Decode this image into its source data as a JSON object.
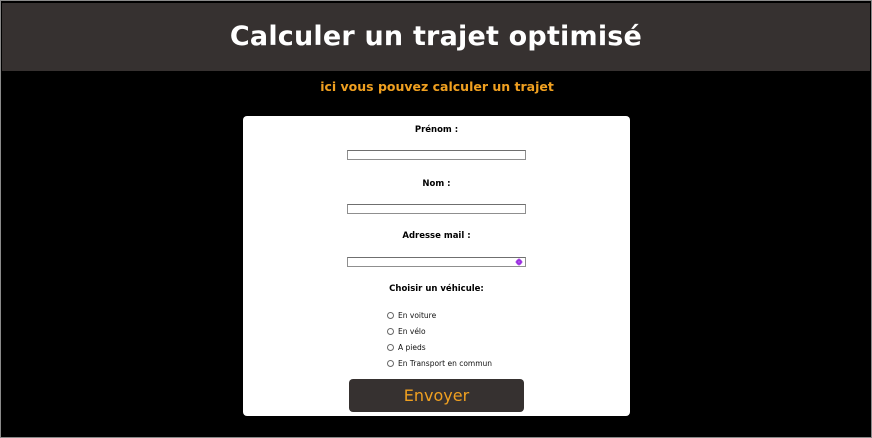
{
  "header": {
    "title": "Calculer un trajet optimisé"
  },
  "subtitle": "ici vous pouvez calculer un trajet",
  "form": {
    "first_name": {
      "label": "Prénom :",
      "value": ""
    },
    "last_name": {
      "label": "Nom :",
      "value": ""
    },
    "email": {
      "label": "Adresse mail :",
      "value": ""
    },
    "vehicle": {
      "label": "Choisir un véhicule:",
      "options": [
        {
          "label": "En voiture",
          "checked": false
        },
        {
          "label": "En vélo",
          "checked": false
        },
        {
          "label": "A pieds",
          "checked": false
        },
        {
          "label": "En Transport en commun",
          "checked": false
        }
      ]
    },
    "submit_label": "Envoyer"
  },
  "colors": {
    "background": "#000000",
    "header_bg": "#363130",
    "accent": "#f0a020",
    "card_bg": "#ffffff",
    "extension_icon": "#9b30e0"
  },
  "icons": {
    "email_field_extension": "password-manager-icon"
  }
}
